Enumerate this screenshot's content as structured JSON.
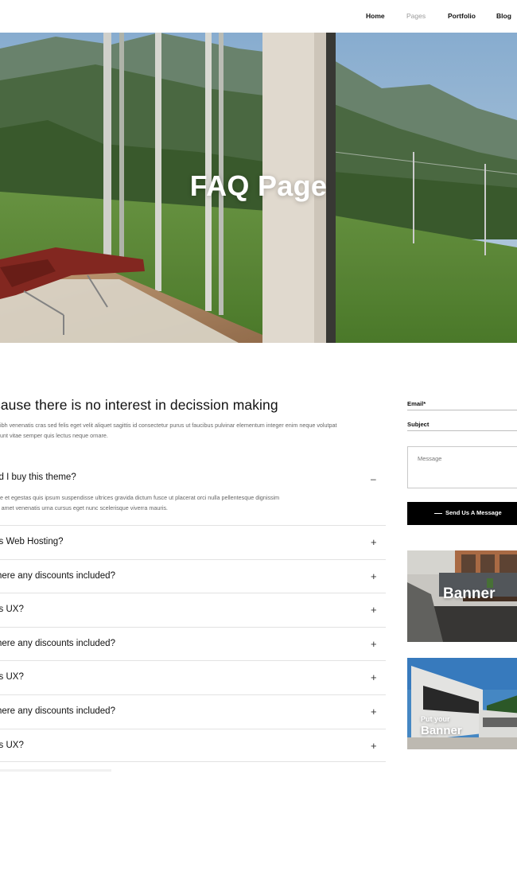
{
  "nav": {
    "items": [
      {
        "label": "Home"
      },
      {
        "label": "Pages"
      },
      {
        "label": "Portfolio"
      },
      {
        "label": "Blog"
      }
    ]
  },
  "hero": {
    "title": "FAQ Page"
  },
  "main": {
    "heading": "cause there is no interest in decission making",
    "text_line1": "nibh venenatis cras sed felis eget velit aliquet sagittis id consectetur purus ut faucibus pulvinar elementum integer enim neque volutpat",
    "text_line2": "dunt vitae semper quis lectus neque ornare."
  },
  "faq": {
    "open_question": "ld I buy this theme?",
    "open_answer_line1": "ue et egestas quis ipsum suspendisse ultrices gravida dictum fusce ut placerat orci nulla pellentesque dignissim",
    "open_answer_line2": "it amet venenatis urna cursus eget nunc scelerisque viverra mauris.",
    "open_toggle": "–",
    "collapsed_toggle": "+",
    "questions": [
      {
        "question": "is Web Hosting?"
      },
      {
        "question": "here any discounts included?"
      },
      {
        "question": "is UX?"
      },
      {
        "question": "here any discounts included?"
      },
      {
        "question": "is UX?"
      },
      {
        "question": "here any discounts included?"
      },
      {
        "question": "is UX?"
      }
    ]
  },
  "sidebar": {
    "email_label": "Email*",
    "subject_label": "Subject",
    "message_placeholder": "Message",
    "send_label": "Send Us A Message",
    "banner1_text": "Banner",
    "banner2_small": "Put your",
    "banner2_big": "Banner"
  },
  "colors": {
    "text_dark": "#111111",
    "text_muted": "#666666",
    "nav_muted": "#9a9a9a",
    "button_bg": "#000000",
    "divider": "#e2e2e2"
  }
}
